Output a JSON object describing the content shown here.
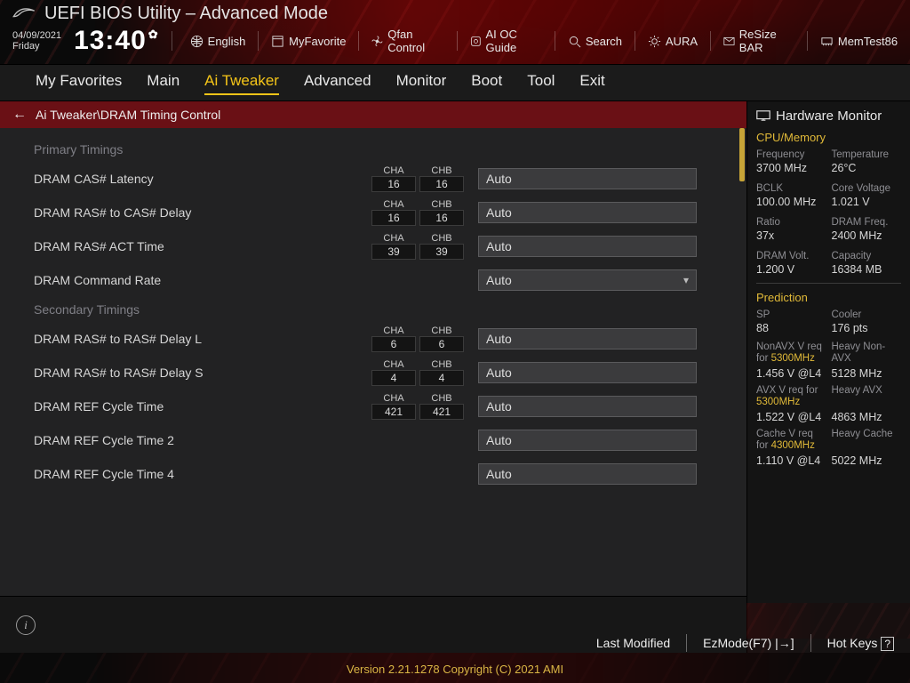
{
  "header": {
    "brand": "ROG",
    "title": "UEFI BIOS Utility – Advanced Mode",
    "date": "04/09/2021",
    "day": "Friday",
    "clock": "13:40",
    "tools": [
      {
        "id": "language",
        "label": "English"
      },
      {
        "id": "myfavorite",
        "label": "MyFavorite"
      },
      {
        "id": "qfan",
        "label": "Qfan Control"
      },
      {
        "id": "aioc",
        "label": "AI OC Guide"
      },
      {
        "id": "search",
        "label": "Search"
      },
      {
        "id": "aura",
        "label": "AURA"
      },
      {
        "id": "resizebar",
        "label": "ReSize BAR"
      },
      {
        "id": "memtest",
        "label": "MemTest86"
      }
    ]
  },
  "tabs": [
    "My Favorites",
    "Main",
    "Ai Tweaker",
    "Advanced",
    "Monitor",
    "Boot",
    "Tool",
    "Exit"
  ],
  "active_tab": "Ai Tweaker",
  "breadcrumb": "Ai Tweaker\\DRAM Timing Control",
  "sections": [
    {
      "title": "Primary Timings",
      "rows": [
        {
          "label": "DRAM CAS# Latency",
          "cha": "16",
          "chb": "16",
          "value": "Auto",
          "type": "input"
        },
        {
          "label": "DRAM RAS# to CAS# Delay",
          "cha": "16",
          "chb": "16",
          "value": "Auto",
          "type": "input"
        },
        {
          "label": "DRAM RAS# ACT Time",
          "cha": "39",
          "chb": "39",
          "value": "Auto",
          "type": "input"
        },
        {
          "label": "DRAM Command Rate",
          "value": "Auto",
          "type": "dropdown"
        }
      ]
    },
    {
      "title": "Secondary Timings",
      "rows": [
        {
          "label": "DRAM RAS# to RAS# Delay L",
          "cha": "6",
          "chb": "6",
          "value": "Auto",
          "type": "input"
        },
        {
          "label": "DRAM RAS# to RAS# Delay S",
          "cha": "4",
          "chb": "4",
          "value": "Auto",
          "type": "input"
        },
        {
          "label": "DRAM REF Cycle Time",
          "cha": "421",
          "chb": "421",
          "value": "Auto",
          "type": "input"
        },
        {
          "label": "DRAM REF Cycle Time 2",
          "value": "Auto",
          "type": "input"
        },
        {
          "label": "DRAM REF Cycle Time 4",
          "value": "Auto",
          "type": "input"
        }
      ]
    }
  ],
  "ch_labels": {
    "a": "CHA",
    "b": "CHB"
  },
  "sidebar": {
    "title": "Hardware Monitor",
    "cpu_mem": {
      "heading": "CPU/Memory",
      "freq_lbl": "Frequency",
      "freq": "3700 MHz",
      "temp_lbl": "Temperature",
      "temp": "26°C",
      "bclk_lbl": "BCLK",
      "bclk": "100.00 MHz",
      "vcore_lbl": "Core Voltage",
      "vcore": "1.021 V",
      "ratio_lbl": "Ratio",
      "ratio": "37x",
      "dramf_lbl": "DRAM Freq.",
      "dramf": "2400 MHz",
      "dramv_lbl": "DRAM Volt.",
      "dramv": "1.200 V",
      "cap_lbl": "Capacity",
      "cap": "16384 MB"
    },
    "prediction": {
      "heading": "Prediction",
      "sp_lbl": "SP",
      "sp": "88",
      "cooler_lbl": "Cooler",
      "cooler": "176 pts",
      "nonavx_lbl_a": "NonAVX V req for ",
      "nonavx_hl": "5300MHz",
      "nonavx_v": "1.456 V @L4",
      "heavy_nonavx_lbl": "Heavy Non-AVX",
      "heavy_nonavx": "5128 MHz",
      "avx_lbl_a": "AVX V req   for ",
      "avx_hl": "5300MHz",
      "avx_v": "1.522 V @L4",
      "heavy_avx_lbl": "Heavy AVX",
      "heavy_avx": "4863 MHz",
      "cache_lbl_a": "Cache V req for ",
      "cache_hl": "4300MHz",
      "cache_v": "1.110 V @L4",
      "heavy_cache_lbl": "Heavy Cache",
      "heavy_cache": "5022 MHz"
    }
  },
  "footer": {
    "last_modified": "Last Modified",
    "ezmode": "EzMode(F7)",
    "hotkeys": "Hot Keys",
    "hotkeys_box": "?",
    "version": "Version 2.21.1278 Copyright (C) 2021 AMI"
  }
}
